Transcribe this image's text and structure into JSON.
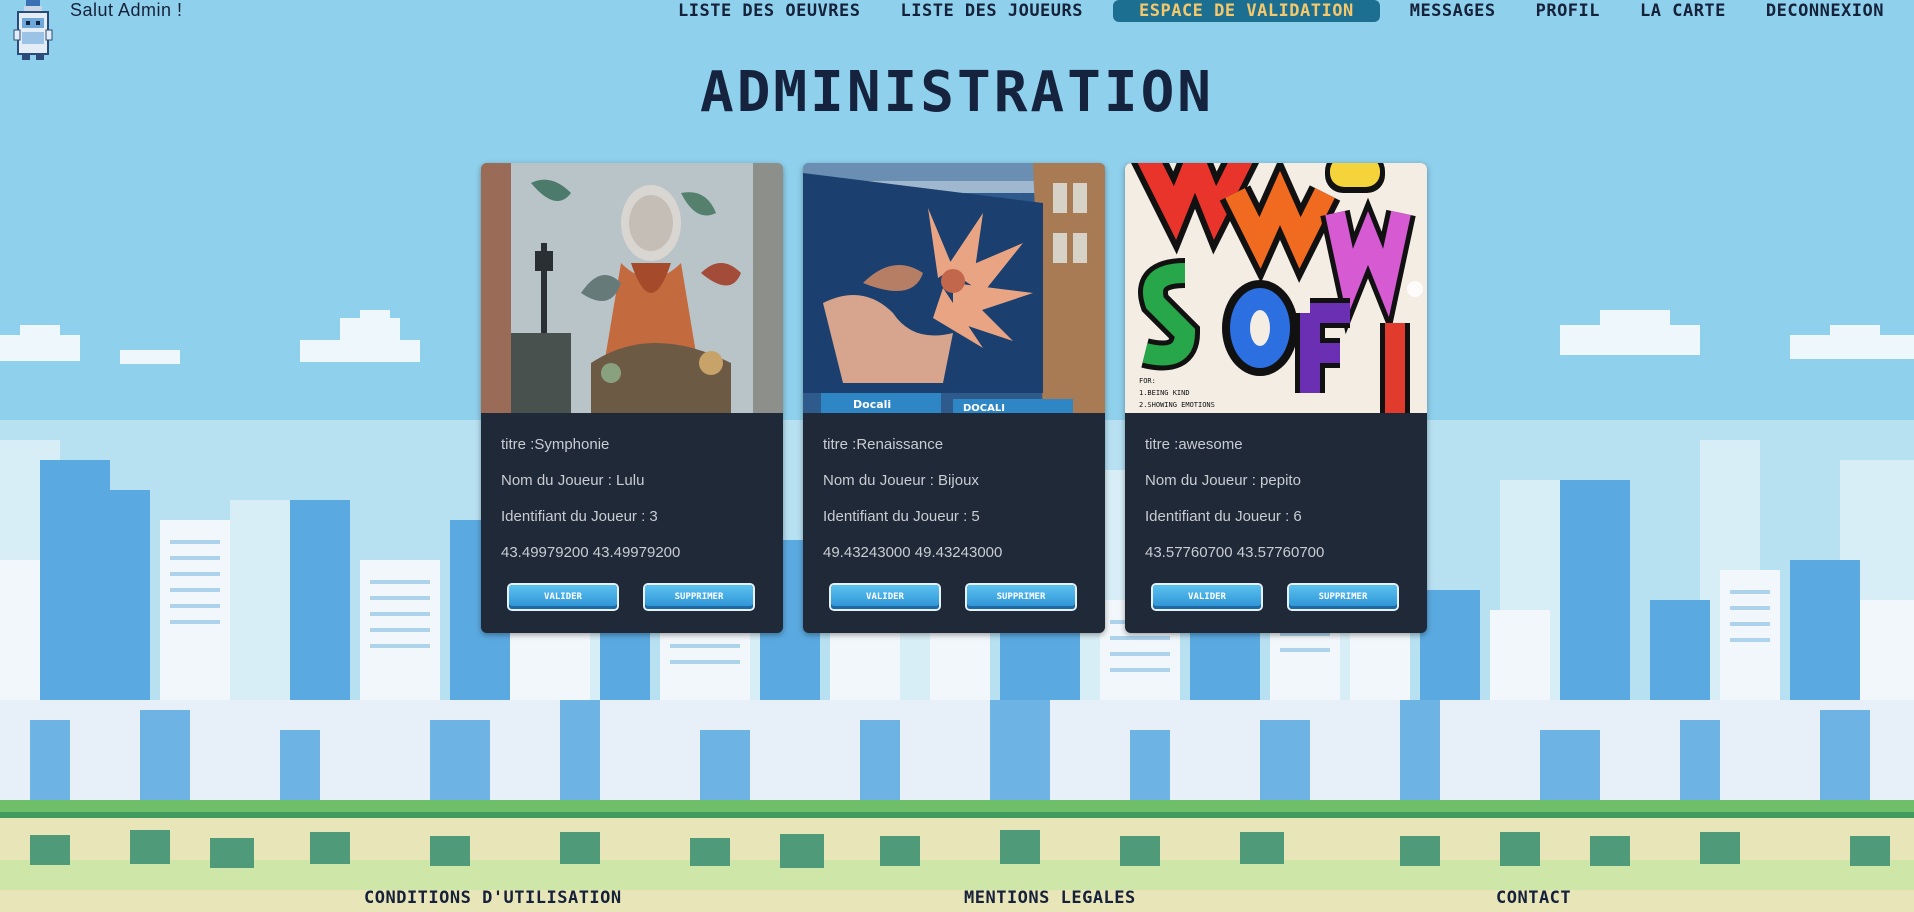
{
  "header": {
    "greeting": "Salut Admin !",
    "nav": [
      {
        "label": "LISTE DES OEUVRES",
        "active": false
      },
      {
        "label": "LISTE DES JOUEURS",
        "active": false
      },
      {
        "label": "ESPACE DE VALIDATION",
        "active": true
      },
      {
        "label": "MESSAGES",
        "active": false
      },
      {
        "label": "PROFIL",
        "active": false
      },
      {
        "label": "LA CARTE",
        "active": false
      },
      {
        "label": "DECONNEXION",
        "active": false
      }
    ]
  },
  "page_title": "ADMINISTRATION",
  "cards": [
    {
      "title_line": "titre :Symphonie",
      "player_line": "Nom du Joueur : Lulu",
      "id_line": "Identifiant du Joueur : 3",
      "coords_line": "43.49979200 43.49979200",
      "validate_label": "VALIDER",
      "delete_label": "SUPPRIMER"
    },
    {
      "title_line": "titre :Renaissance",
      "player_line": "Nom du Joueur : Bijoux",
      "id_line": "Identifiant du Joueur : 5",
      "coords_line": "49.43243000 49.43243000",
      "validate_label": "VALIDER",
      "delete_label": "SUPPRIMER",
      "photo_sign_left": "Docali",
      "photo_sign_right": "DOCALI"
    },
    {
      "title_line": "titre :awesome",
      "player_line": "Nom du Joueur : pepito",
      "id_line": "Identifiant du Joueur : 6",
      "coords_line": "43.57760700 43.57760700",
      "validate_label": "VALIDER",
      "delete_label": "SUPPRIMER",
      "photo_caption_1": "FOR:",
      "photo_caption_2": "1.BEING KIND",
      "photo_caption_3": "2.SHOWING EMOTIONS"
    }
  ],
  "footer": {
    "terms": "CONDITIONS D'UTILISATION",
    "legal": "MENTIONS LEGALES",
    "contact": "CONTACT"
  },
  "colors": {
    "sky": "#8fd0ec",
    "card_bg": "#1f2937",
    "nav_active_bg": "#1d6f91",
    "nav_active_text": "#f4c86b",
    "text_dark": "#16213a"
  }
}
